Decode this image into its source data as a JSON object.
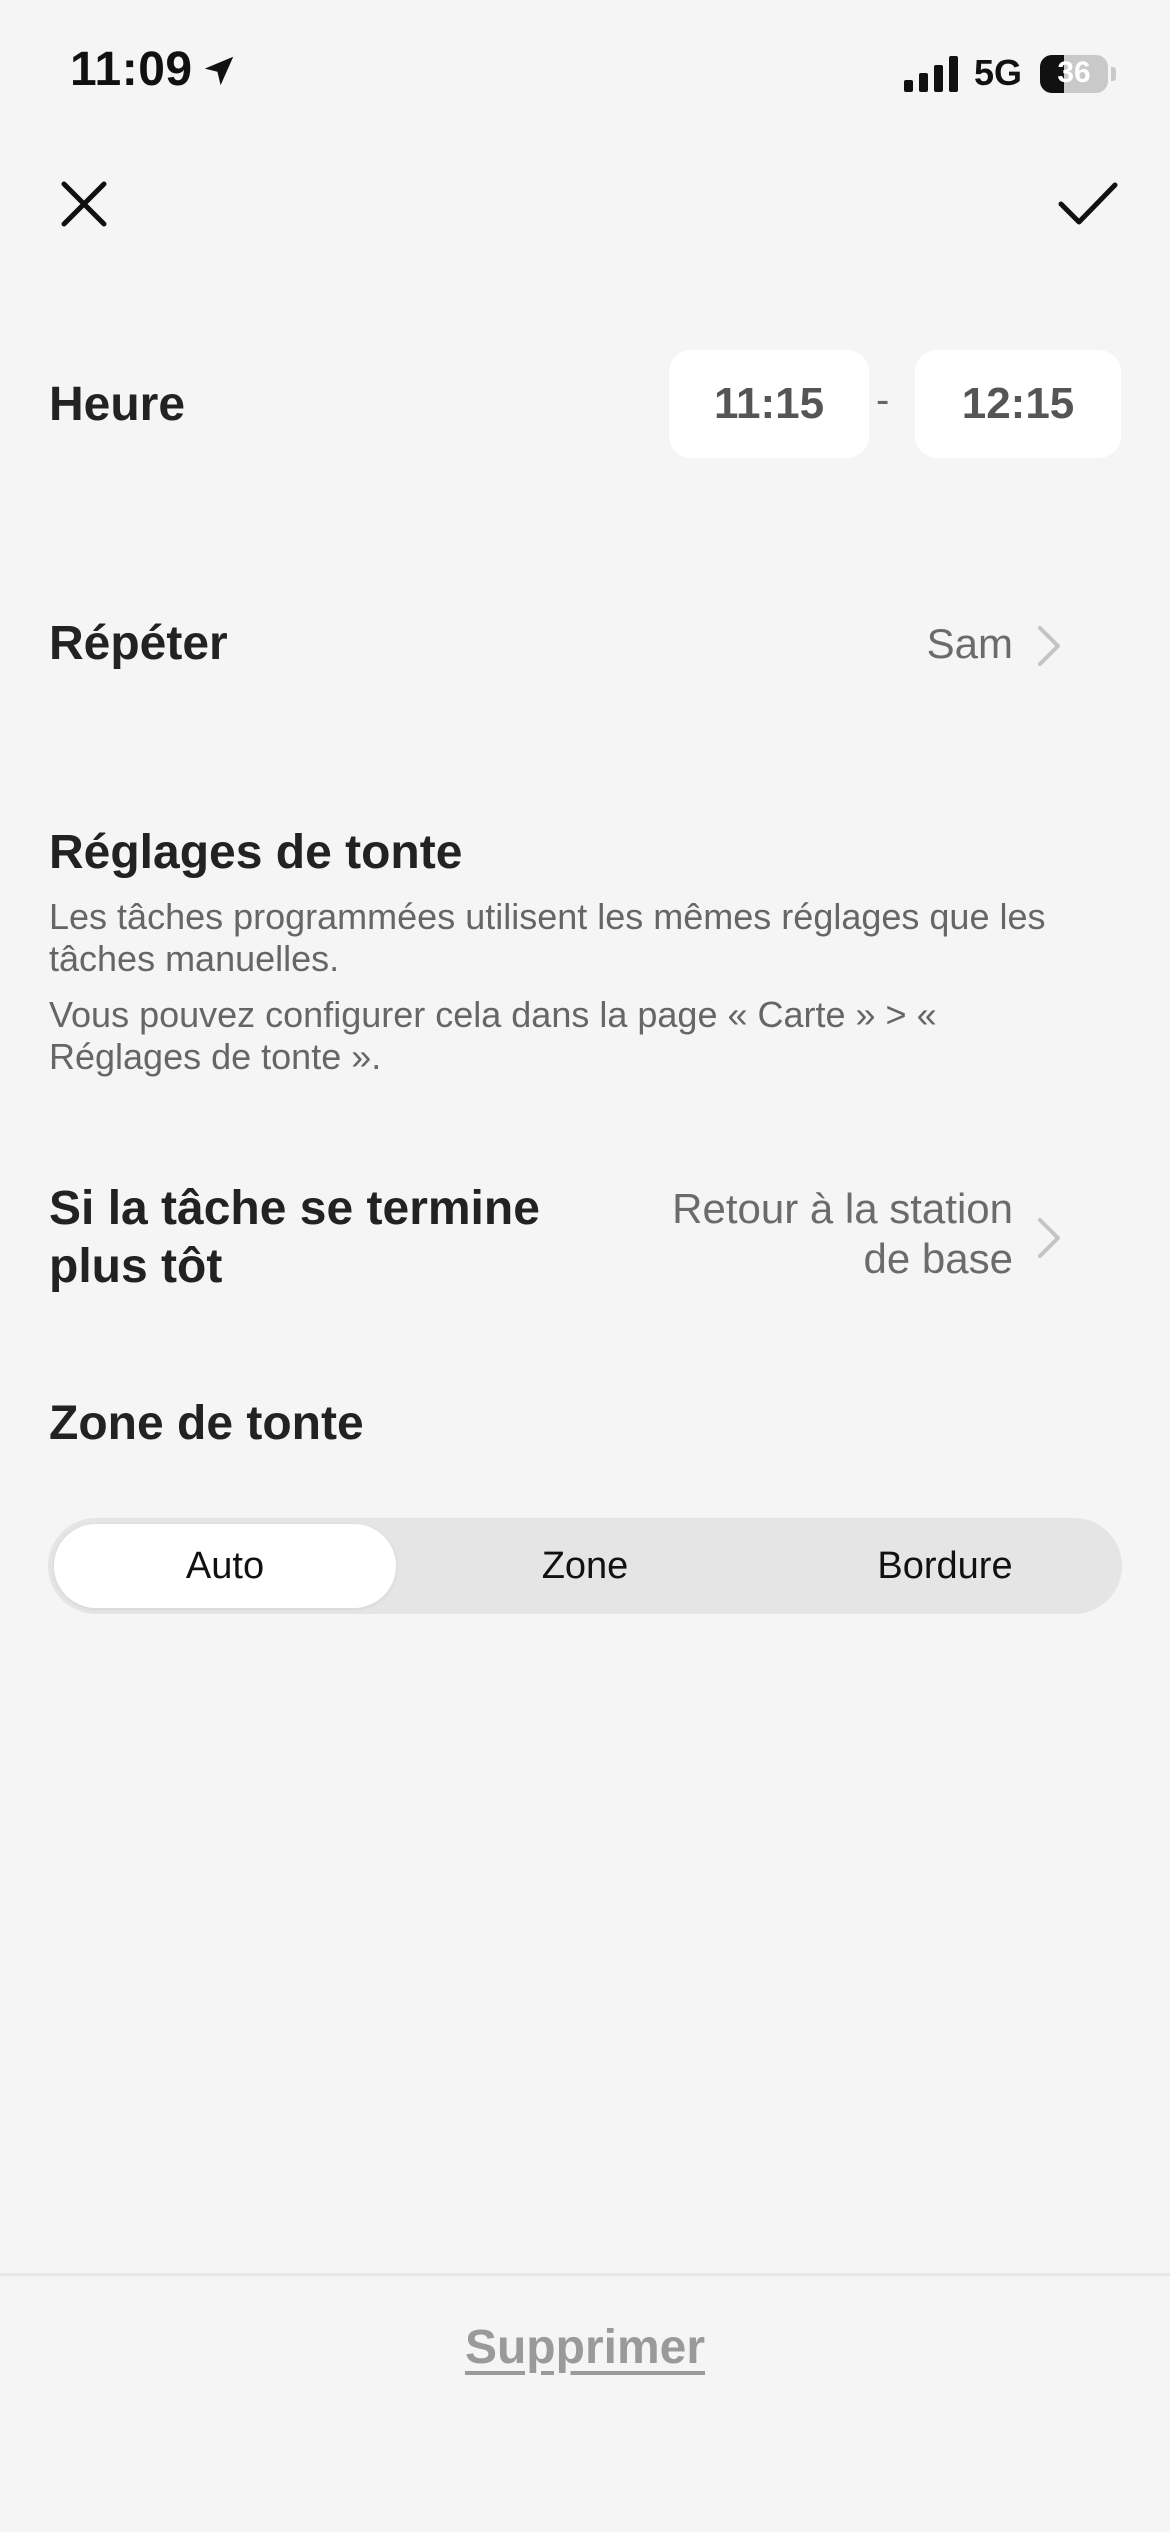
{
  "status_bar": {
    "time": "11:09",
    "network": "5G",
    "battery_percent": "36",
    "battery_level": 0.36
  },
  "nav": {
    "close_icon": "close-icon",
    "confirm_icon": "checkmark-icon"
  },
  "time_row": {
    "label": "Heure",
    "start": "11:15",
    "separator": "-",
    "end": "12:15"
  },
  "repeat_row": {
    "label": "Répéter",
    "value": "Sam"
  },
  "mowing_settings": {
    "title": "Réglages de tonte",
    "description_1": "Les tâches programmées utilisent les mêmes réglages que les tâches manuelles.",
    "description_2": "Vous pouvez configurer cela dans la page « Carte » > « Réglages de tonte »."
  },
  "early_finish_row": {
    "label_line1": "Si la tâche se termine",
    "label_line2": "plus tôt",
    "value_line1": "Retour à la station",
    "value_line2": "de base"
  },
  "mowing_zone": {
    "title": "Zone de tonte",
    "options": [
      "Auto",
      "Zone",
      "Bordure"
    ],
    "selected": "Auto"
  },
  "footer": {
    "delete_label": "Supprimer"
  },
  "colors": {
    "background": "#f5f5f5",
    "text_primary": "#222222",
    "text_secondary": "#6b6b6b",
    "card": "#ffffff",
    "segment_track": "#e5e5e5",
    "delete_text": "#9a9a9a"
  }
}
